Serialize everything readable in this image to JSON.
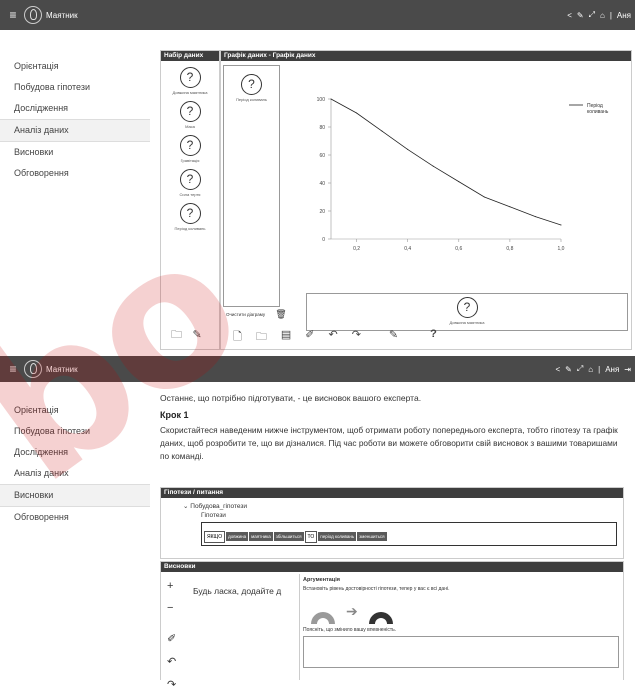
{
  "app": {
    "title": "Маятник",
    "user": "Аня"
  },
  "sidebar": {
    "items": [
      "Орієнтація",
      "Побудова гіпотези",
      "Дослідження",
      "Аналіз даних",
      "Висновки",
      "Обговорення"
    ]
  },
  "top_panel": {
    "dataset_header": "Набір даних",
    "graph_header": "Графік даних - Графік даних",
    "variables": [
      "Довжина маятника",
      "Маса",
      "Гравітація",
      "Сила тертя",
      "Період коливань"
    ],
    "selected_var": "Період коливань",
    "clear_label": "Очистити діаграму",
    "x_var_label": "Довжина маятника",
    "question_mark": "?"
  },
  "chart_data": {
    "type": "line",
    "title": "",
    "xlabel": "",
    "ylabel": "",
    "x": [
      0.1,
      0.2,
      0.3,
      0.4,
      0.5,
      0.6,
      0.7,
      0.8,
      0.9,
      1.0
    ],
    "series": [
      {
        "name": "Період коливань",
        "values": [
          100,
          90,
          77,
          64,
          52,
          41,
          30,
          23,
          16,
          10
        ]
      }
    ],
    "xticks": [
      "0,2",
      "0,4",
      "0,6",
      "0,8",
      "1,0"
    ],
    "yticks": [
      "0",
      "20",
      "40",
      "60",
      "80",
      "100"
    ],
    "xlim": [
      0.1,
      1.0
    ],
    "ylim": [
      0,
      100
    ],
    "legend": "top-right",
    "color": "#222222"
  },
  "bottom": {
    "intro": "Останнє, що потрібно підготувати, - це висновок вашого експерта.",
    "step_title": "Крок 1",
    "step_text": "Скористайтеся наведеним нижче інструментом, щоб отримати роботу попереднього експерта, тобто гіпотезу та графік даних, щоб розробити те, що ви дізналися. Під час роботи ви можете обговорити свій висновок з вашими товаришами по команді.",
    "hyp_header": "Гіпотези / питання",
    "tree_root": "Побудова_гіпотези",
    "tree_child": "Гіпотези",
    "tags": [
      "ЯКЩО",
      "довжина",
      "маятника",
      "збільшиться",
      "ТО",
      "період коливань",
      "зменшиться"
    ],
    "concl_header": "Висновки",
    "add_prompt": "Будь ласка, додайте д",
    "arg_title": "Аргументація",
    "arg_text": "Встановіть рівень достовірності гіпотези, тепер у вас є всі дані.",
    "explain_text": "Поясніть, що змінило вашу впевненість."
  },
  "watermark": "bo"
}
